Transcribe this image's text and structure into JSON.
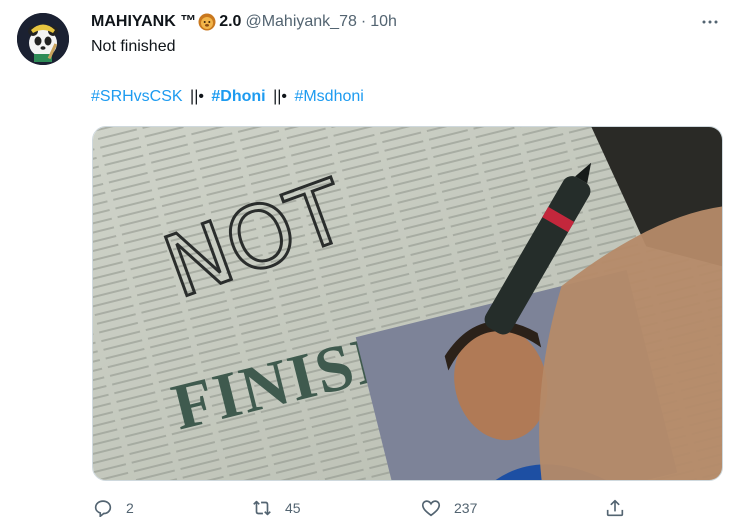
{
  "tweet": {
    "display_name": "MAHIYANK ™",
    "version": "2.0",
    "handle": "@Mahiyank_78",
    "separator": "·",
    "time": "10h",
    "text": "Not finished",
    "hashtags": [
      {
        "text": "#SRHvsCSK",
        "bold": false
      },
      {
        "text": "#Dhoni",
        "bold": true
      },
      {
        "text": "#Msdhoni",
        "bold": false
      }
    ],
    "hashtag_separator": "||•",
    "media": {
      "headline_top": "NOT",
      "headline_main": "FINISHED"
    }
  },
  "actions": {
    "replies": "2",
    "retweets": "45",
    "likes": "237"
  },
  "icons": {
    "avatar": "panda-avatar",
    "emoji": "lion-face-icon",
    "more": "more-icon",
    "reply": "reply-icon",
    "retweet": "retweet-icon",
    "like": "heart-icon",
    "share": "share-icon"
  },
  "colors": {
    "link": "#1d9bf0",
    "secondary_text": "#536471",
    "primary_text": "#0f1419"
  }
}
